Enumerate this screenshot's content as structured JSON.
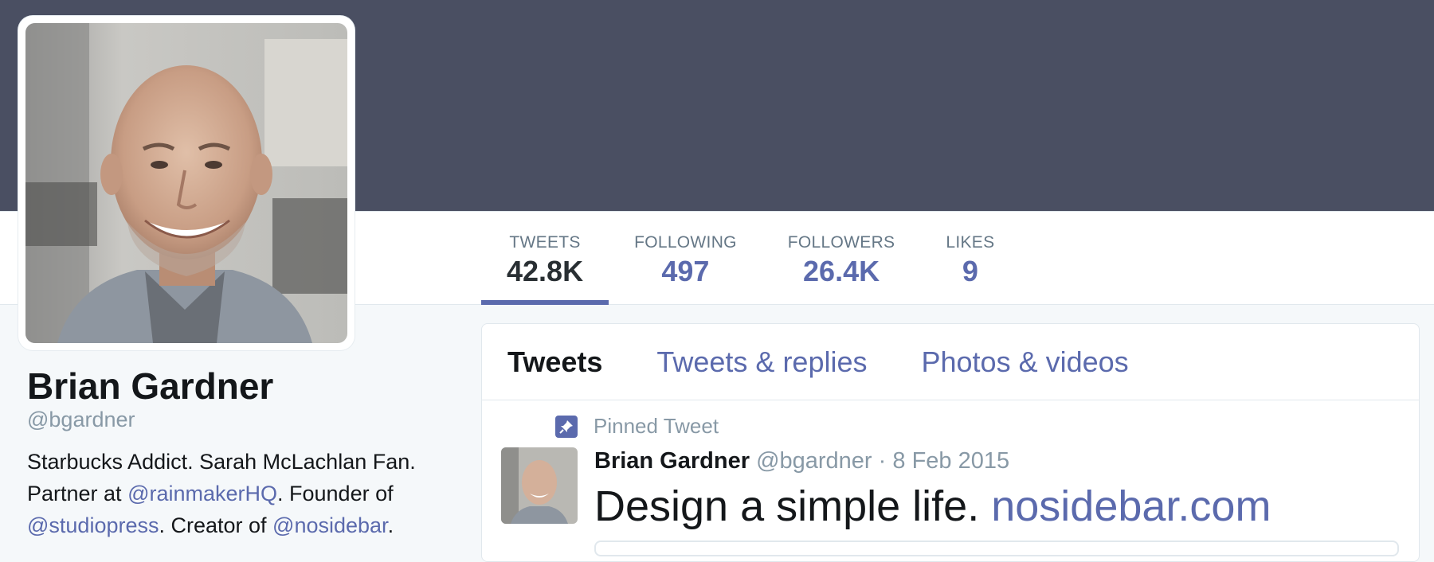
{
  "profile": {
    "name": "Brian Gardner",
    "handle": "@bgardner",
    "bio": {
      "line1": "Starbucks Addict. Sarah McLachlan Fan.",
      "line2_prefix": "Partner at ",
      "line2_link": "@rainmakerHQ",
      "line2_suffix": ". Founder of",
      "line3_link1": "@studiopress",
      "line3_mid": ". Creator of ",
      "line3_link2": "@nosidebar",
      "line3_suffix": "."
    }
  },
  "stats": [
    {
      "label": "TWEETS",
      "value": "42.8K"
    },
    {
      "label": "FOLLOWING",
      "value": "497"
    },
    {
      "label": "FOLLOWERS",
      "value": "26.4K"
    },
    {
      "label": "LIKES",
      "value": "9"
    }
  ],
  "tabs": [
    {
      "label": "Tweets"
    },
    {
      "label": "Tweets & replies"
    },
    {
      "label": "Photos & videos"
    }
  ],
  "tweet": {
    "pinned_label": "Pinned Tweet",
    "author_name": "Brian Gardner",
    "author_handle": "@bgardner",
    "separator": "·",
    "date": "8 Feb 2015",
    "text": "Design a simple life. ",
    "link": "nosidebar.com"
  },
  "icons": {
    "pin": "pin-icon"
  },
  "colors": {
    "banner": "#4a4f62",
    "accent": "#5b6aad",
    "text": "#14171a",
    "muted": "#8899a6"
  }
}
